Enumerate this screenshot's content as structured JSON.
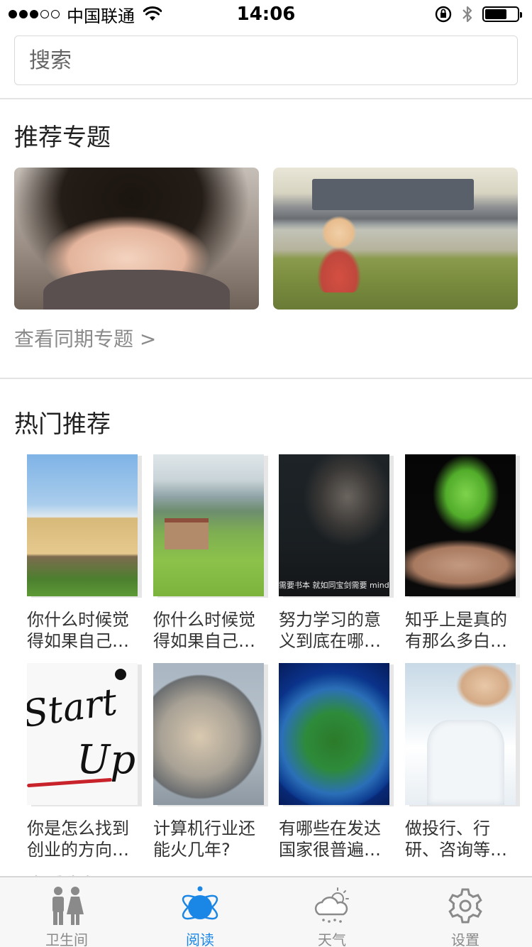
{
  "status_bar": {
    "carrier": "中国联通",
    "time": "14:06",
    "signal_bars_filled": 3,
    "signal_bars_total": 5
  },
  "search": {
    "placeholder": "搜索"
  },
  "recommended_topics": {
    "title": "推荐专题",
    "view_more": "查看同期专题 >"
  },
  "hot": {
    "title": "热门推荐",
    "items": [
      {
        "caption": "你什么时候觉得如果自己…"
      },
      {
        "caption": "你什么时候觉得如果自己…"
      },
      {
        "caption": "努力学习的意义到底在哪…",
        "overlay": "需要书本 就如同宝剑需要 mind needs books like a sword needs a whetstone"
      },
      {
        "caption": "知乎上是真的有那么多白…"
      },
      {
        "caption": "你是怎么找到创业的方向…",
        "image_text_1": "Start",
        "image_text_2": "Up"
      },
      {
        "caption": "计算机行业还能火几年?"
      },
      {
        "caption": "有哪些在发达国家很普遍…"
      },
      {
        "caption": "做投行、行研、咨询等…"
      }
    ]
  },
  "peek_text": "查看全部",
  "tab_bar": {
    "accent": "#1a86e6",
    "tabs": [
      {
        "label": "卫生间",
        "icon": "restroom-icon"
      },
      {
        "label": "阅读",
        "icon": "atom-icon"
      },
      {
        "label": "天气",
        "icon": "weather-icon"
      },
      {
        "label": "设置",
        "icon": "gear-icon"
      }
    ],
    "active_index": 1
  }
}
